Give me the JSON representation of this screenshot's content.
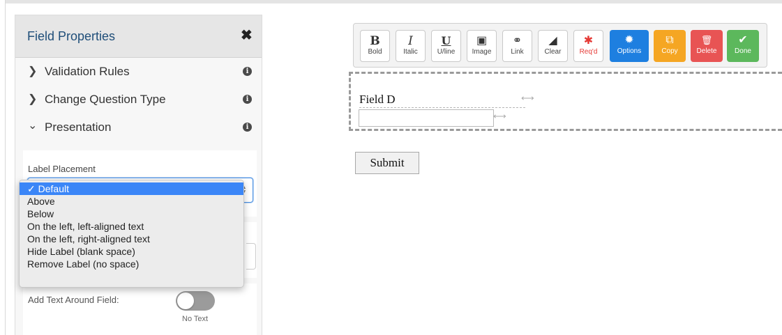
{
  "panel": {
    "title": "Field Properties",
    "close_icon": "close-icon",
    "sections": [
      {
        "label": "Validation Rules",
        "chevron": "chevron-right-icon",
        "info_icon": "info-icon"
      },
      {
        "label": "Change Question Type",
        "chevron": "chevron-right-icon",
        "info_icon": "info-icon"
      },
      {
        "label": "Presentation",
        "chevron": "chevron-down-icon",
        "info_icon": "info-icon"
      }
    ],
    "label_placement": {
      "label": "Label Placement",
      "selected": "Default",
      "options": [
        "Default",
        "Above",
        "Below",
        "On the left, left-aligned text",
        "On the left, right-aligned text",
        "Hide Label (blank space)",
        "Remove Label (no space)"
      ]
    },
    "add_text": {
      "label": "Add Text Around Field:",
      "state": "No Text"
    }
  },
  "toolbar": {
    "buttons": [
      {
        "label": "Bold",
        "icon": "bold-icon",
        "glyph": "B"
      },
      {
        "label": "Italic",
        "icon": "italic-icon",
        "glyph": "I"
      },
      {
        "label": "U/line",
        "icon": "underline-icon",
        "glyph": "U"
      },
      {
        "label": "Image",
        "icon": "image-icon",
        "glyph": "▣"
      },
      {
        "label": "Link",
        "icon": "link-icon",
        "glyph": "⚭"
      },
      {
        "label": "Clear",
        "icon": "eraser-icon",
        "glyph": "◢"
      },
      {
        "label": "Req'd",
        "icon": "asterisk-icon",
        "glyph": "✱"
      },
      {
        "label": "Options",
        "icon": "gear-icon",
        "glyph": "✹"
      },
      {
        "label": "Copy",
        "icon": "copy-icon",
        "glyph": "⧉"
      },
      {
        "label": "Delete",
        "icon": "trash-icon",
        "glyph": "🗑"
      },
      {
        "label": "Done",
        "icon": "check-icon",
        "glyph": "✔"
      }
    ],
    "colors": {
      "options": "#1e7fe0",
      "copy": "#f5a623",
      "delete": "#e85454",
      "done": "#5cb85c",
      "required": "#e53935"
    }
  },
  "canvas": {
    "field_label": "Field D",
    "submit_label": "Submit"
  }
}
